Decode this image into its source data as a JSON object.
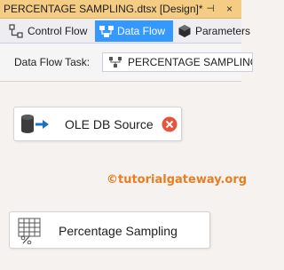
{
  "document_tab": {
    "title": "PERCENTAGE SAMPLING.dtsx [Design]*",
    "pin_glyph": "⊣",
    "close_glyph": "×"
  },
  "designer_tabs": [
    {
      "label": "Control Flow",
      "icon": "control-flow-icon"
    },
    {
      "label": "Data Flow",
      "icon": "data-flow-icon",
      "active": true
    },
    {
      "label": "Parameters",
      "icon": "parameters-icon"
    }
  ],
  "toolbar": {
    "task_label": "Data Flow Task:",
    "task_value": "PERCENTAGE SAMPLING"
  },
  "canvas": {
    "components": [
      {
        "name": "OLE DB Source",
        "icon": "ole-db-source-icon",
        "status": "error",
        "status_color": "#e8543b"
      },
      {
        "name": "Percentage Sampling",
        "icon": "percentage-sampling-icon"
      }
    ],
    "watermark": "©tutorialgateway.org"
  },
  "colors": {
    "active_tab": "#3399ff",
    "document_tab": "#f5cc84",
    "watermark": "#e67e22"
  }
}
